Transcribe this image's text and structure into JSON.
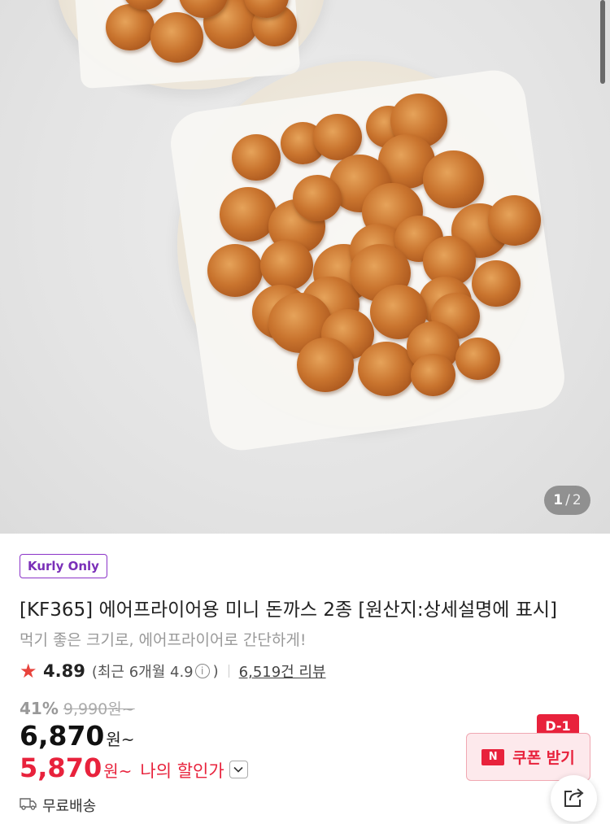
{
  "gallery": {
    "current": "1",
    "separator": "/",
    "total": "2"
  },
  "product": {
    "badge": "Kurly Only",
    "title": "[KF365] 에어프라이어용 미니 돈까스 2종 [원산지:상세설명에 표시]",
    "subtitle": "먹기 좋은 크기로, 에어프라이어로 간단하게!"
  },
  "rating": {
    "score": "4.89",
    "recent_prefix": "(최근 6개월 4.9",
    "recent_suffix": ")",
    "info_icon": "i",
    "review_count": "6,519건 리뷰"
  },
  "price": {
    "discount_rate": "41%",
    "original": "9,990원~",
    "current": "6,870",
    "current_unit": "원~",
    "my_price": "5,870",
    "my_unit": "원~",
    "my_label": "나의 할인가"
  },
  "shipping": {
    "label": "무료배송"
  },
  "coupon": {
    "tag": "D-1",
    "logo": "N",
    "label": "쿠폰 받기"
  },
  "colors": {
    "accent_purple": "#7a2fb8",
    "accent_red": "#e8223c",
    "star": "#e8433c"
  },
  "icons": [
    "star-icon",
    "info-icon",
    "chevron-down-icon",
    "truck-icon",
    "share-icon"
  ]
}
